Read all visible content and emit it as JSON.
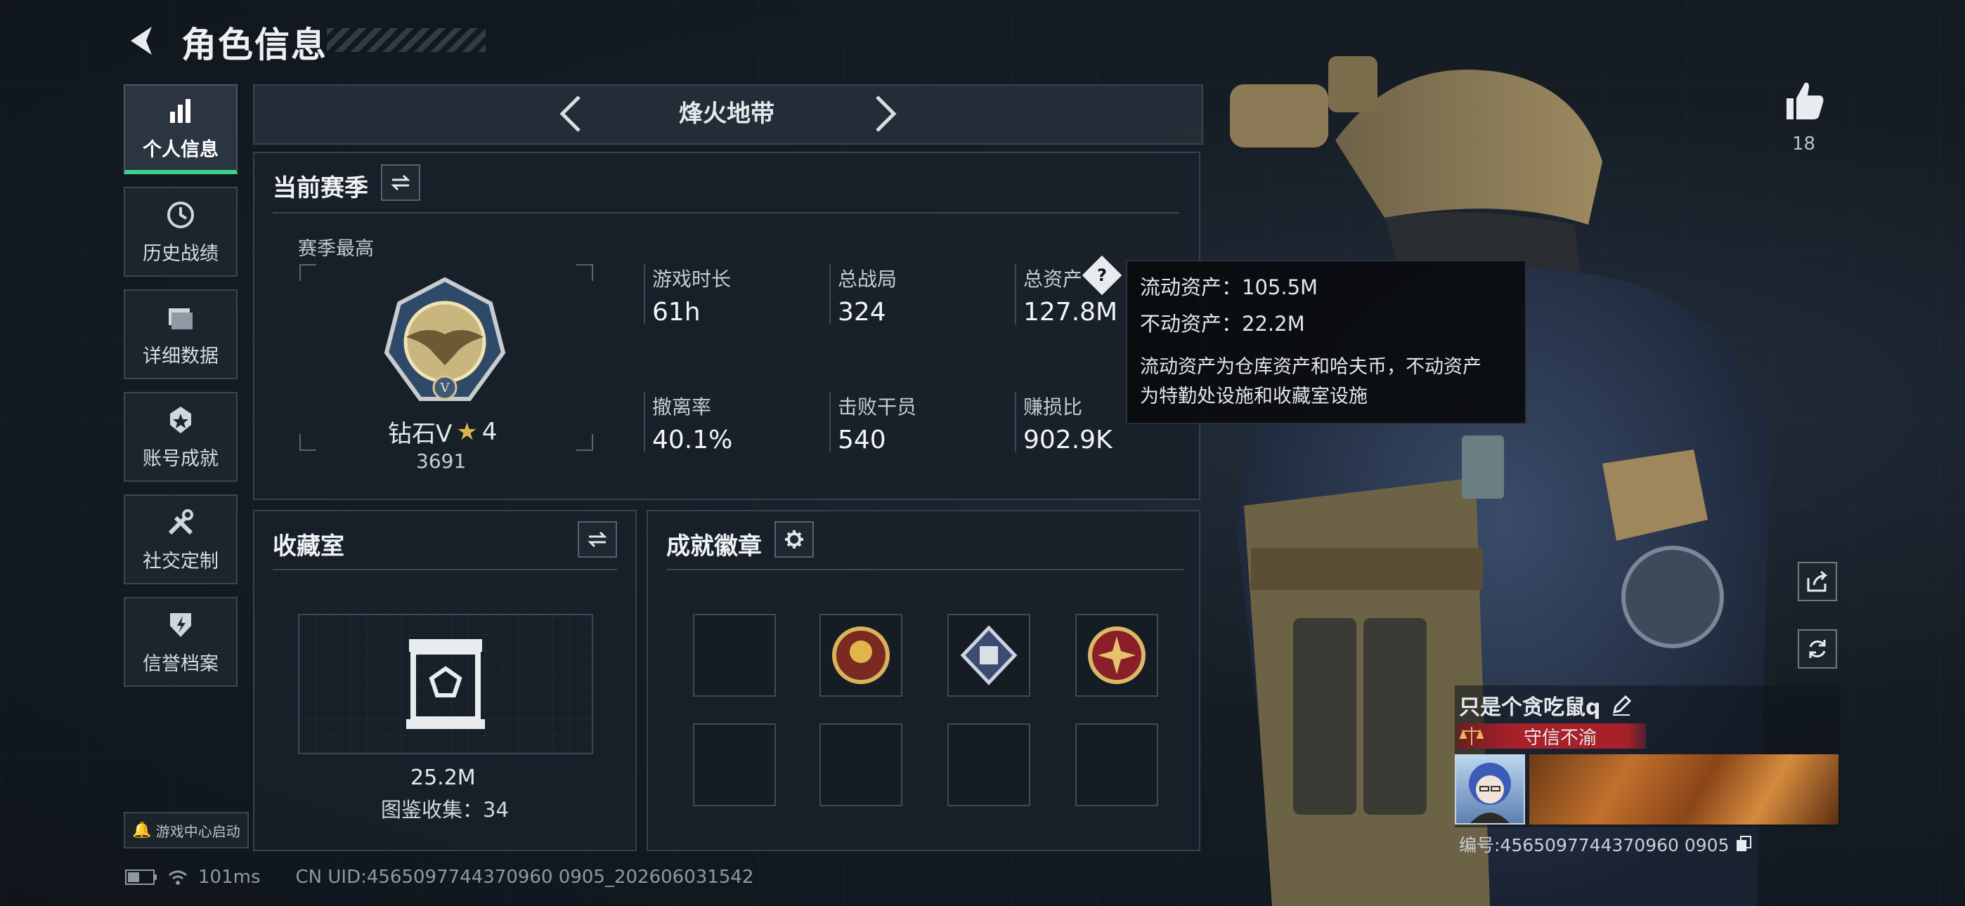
{
  "header": {
    "title": "角色信息"
  },
  "sidebar": {
    "items": [
      {
        "label": "个人信息",
        "icon": "bar-chart-icon",
        "active": true
      },
      {
        "label": "历史战绩",
        "icon": "history-icon"
      },
      {
        "label": "详细数据",
        "icon": "folder-icon"
      },
      {
        "label": "账号成就",
        "icon": "achievement-icon"
      },
      {
        "label": "社交定制",
        "icon": "tools-icon"
      },
      {
        "label": "信誉档案",
        "icon": "credit-icon"
      }
    ],
    "launch_label": "游戏中心启动"
  },
  "status": {
    "latency": "101ms",
    "uid": "CN UID:4565097744370960 0905_202606031542"
  },
  "mode": {
    "title": "烽火地带"
  },
  "season": {
    "section_title": "当前赛季",
    "best_label": "赛季最高",
    "rank_name": "钻石V",
    "rank_stars": "4",
    "rank_score": "3691",
    "stats": [
      {
        "label": "游戏时长",
        "value": "61h"
      },
      {
        "label": "总战局",
        "value": "324"
      },
      {
        "label": "总资产",
        "value": "127.8M"
      },
      {
        "label": "撤离率",
        "value": "40.1%"
      },
      {
        "label": "击败干员",
        "value": "540"
      },
      {
        "label": "赚损比",
        "value": "902.9K"
      }
    ]
  },
  "tooltip": {
    "line1": "流动资产：105.5M",
    "line2": "不动资产：22.2M",
    "line3": "流动资产为仓库资产和哈夫币，不动资产",
    "line4": "为特勤处设施和收藏室设施"
  },
  "collection": {
    "section_title": "收藏室",
    "value": "25.2M",
    "catalog": "图鉴收集：34"
  },
  "badges": {
    "section_title": "成就徽章"
  },
  "player": {
    "likes": "18",
    "name": "只是个贪吃鼠q",
    "title_tag": "守信不渝",
    "id_label": "编号:4565097744370960 0905"
  },
  "colors": {
    "accent": "#3bd28a",
    "title_tag_bg": "#a8212a"
  }
}
